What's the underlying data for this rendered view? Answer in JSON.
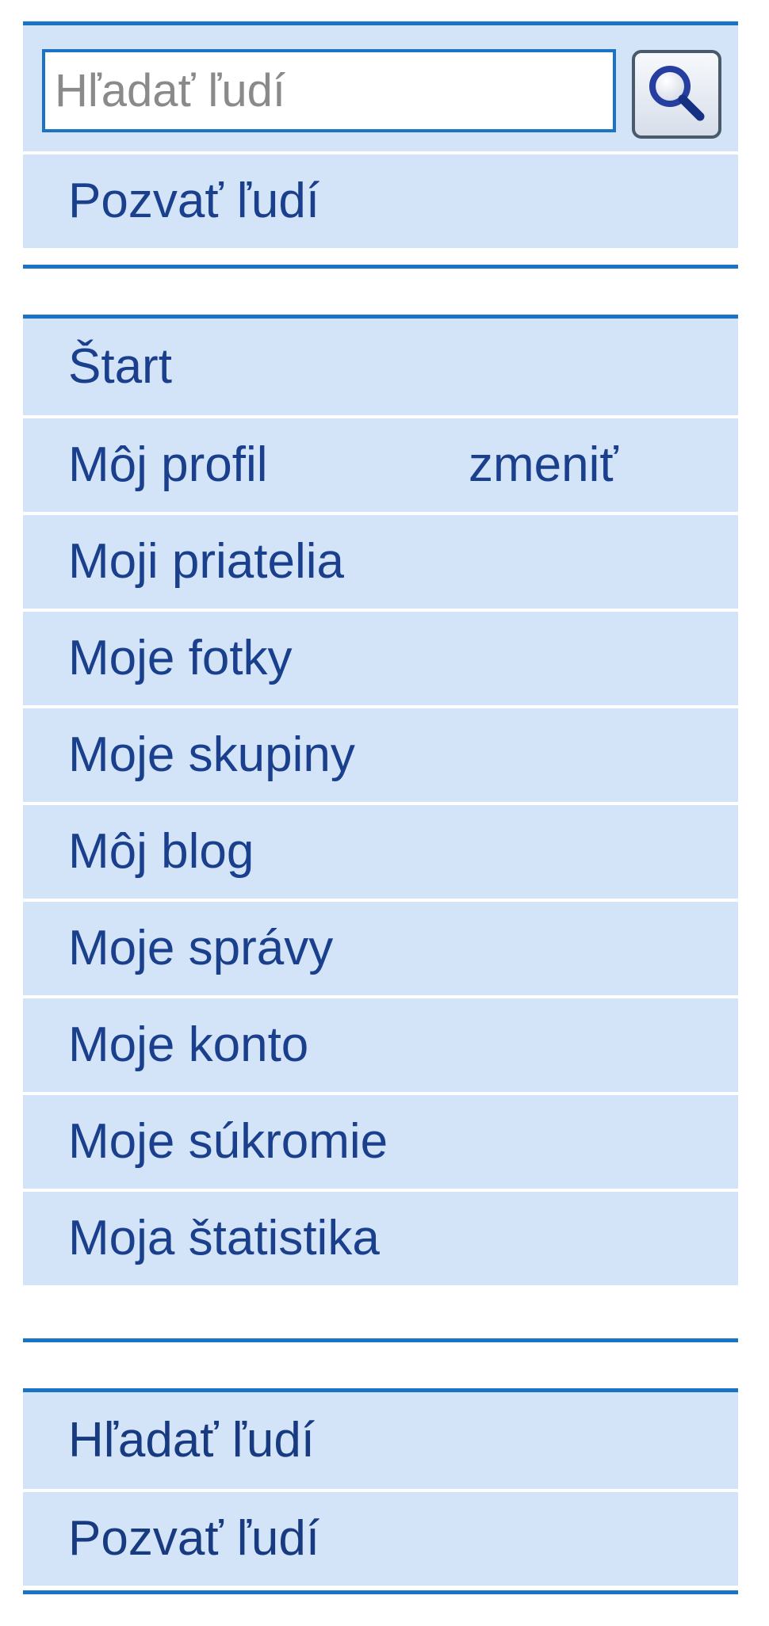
{
  "search": {
    "placeholder": "Hľadať ľudí",
    "button_icon": "magnifier-icon"
  },
  "top_links": [
    {
      "label": "Pozvať ľudí"
    }
  ],
  "nav": [
    {
      "label": "Štart"
    },
    {
      "label": "Môj profil",
      "action_label": "zmeniť"
    },
    {
      "label": "Moji priatelia"
    },
    {
      "label": "Moje fotky"
    },
    {
      "label": "Moje skupiny"
    },
    {
      "label": "Môj blog"
    },
    {
      "label": "Moje správy"
    },
    {
      "label": "Moje konto"
    },
    {
      "label": "Moje súkromie"
    },
    {
      "label": "Moja štatistika"
    }
  ],
  "bottom_links": [
    {
      "label": "Hľadať ľudí"
    },
    {
      "label": "Pozvať ľudí"
    }
  ],
  "colors": {
    "accent": "#1a73c4",
    "row_bg": "#d3e4f8",
    "link_text": "#1a3f8c"
  }
}
